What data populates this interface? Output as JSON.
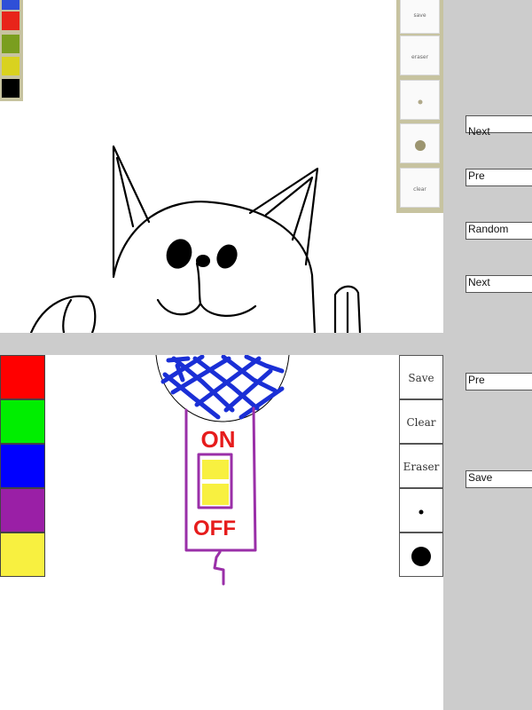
{
  "top_panel": {
    "palette": [
      {
        "name": "blue",
        "color": "#2f4fd7"
      },
      {
        "name": "red",
        "color": "#e8241a"
      },
      {
        "name": "olive-green",
        "color": "#7a9e1f"
      },
      {
        "name": "yellow",
        "color": "#d9d21f"
      },
      {
        "name": "black",
        "color": "#000000"
      }
    ],
    "tools": {
      "save_label": "save",
      "eraser_label": "eraser",
      "clear_label": "clear",
      "small_brush_icon": "small-dot",
      "large_brush_icon": "large-dot"
    },
    "drawing": "cat-face-sketch"
  },
  "bottom_panel": {
    "palette": [
      {
        "name": "red",
        "color": "#ff0000"
      },
      {
        "name": "green",
        "color": "#00ee00"
      },
      {
        "name": "blue",
        "color": "#0000ff"
      },
      {
        "name": "purple",
        "color": "#9a1fa6"
      },
      {
        "name": "yellow",
        "color": "#f8f040"
      }
    ],
    "tools": {
      "save_label": "Save",
      "clear_label": "Clear",
      "eraser_label": "Eraser",
      "small_brush_icon": "small-dot",
      "large_brush_icon": "large-dot"
    },
    "drawing": {
      "on_label": "ON",
      "off_label": "OFF"
    }
  },
  "nav": {
    "next_1": "Next",
    "pre_1": "Pre",
    "random": "Random",
    "next_2": "Next",
    "pre_2": "Pre",
    "save": "Save"
  }
}
